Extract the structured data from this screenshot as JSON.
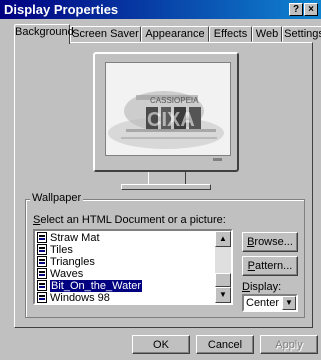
{
  "window": {
    "title": "Display Properties",
    "help_label": "?",
    "close_label": "×"
  },
  "tabs": [
    {
      "label": "Background",
      "active": true
    },
    {
      "label": "Screen Saver"
    },
    {
      "label": "Appearance"
    },
    {
      "label": "Effects"
    },
    {
      "label": "Web"
    },
    {
      "label": "Settings"
    }
  ],
  "preview": {
    "logo_line1": "CASSIOPEIA",
    "logo_line2": "CIXA"
  },
  "wallpaper": {
    "group_label": "Wallpaper",
    "select_label_key": "S",
    "select_label_rest": "elect an HTML Document or a picture:",
    "items": [
      {
        "label": "Straw Mat"
      },
      {
        "label": "Tiles"
      },
      {
        "label": "Triangles"
      },
      {
        "label": "Waves"
      },
      {
        "label": "Bit_On_the_Water",
        "selected": true
      },
      {
        "label": "Windows 98"
      }
    ],
    "browse_key": "B",
    "browse_rest": "rowse...",
    "pattern_key": "P",
    "pattern_rest": "attern...",
    "display_key": "D",
    "display_rest": "isplay:",
    "display_value": "Center"
  },
  "footer": {
    "ok_label": "OK",
    "cancel_label": "Cancel",
    "apply_label": "Apply"
  },
  "colors": {
    "title_bar": "#000080",
    "face": "#c0c0c0",
    "selection": "#000080"
  }
}
